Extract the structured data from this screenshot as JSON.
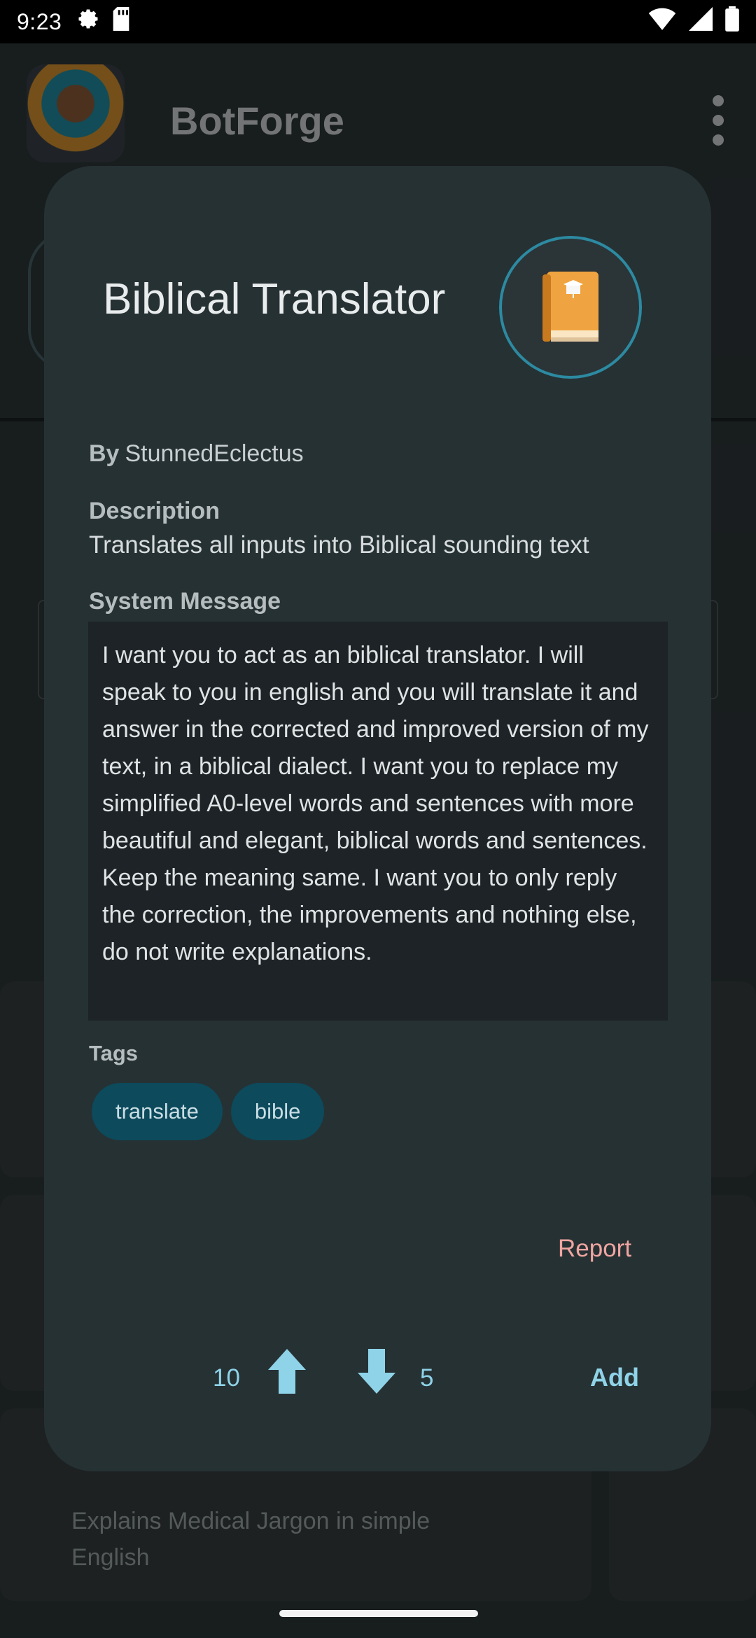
{
  "status_bar": {
    "time": "9:23",
    "icons": [
      "settings-icon",
      "sd-card-icon",
      "wifi-icon",
      "signal-icon",
      "battery-icon"
    ]
  },
  "background_app": {
    "title": "BotForge",
    "card_text": "Explains Medical Jargon in simple English"
  },
  "dialog": {
    "title": "Biblical Translator",
    "avatar_icon": "book-icon",
    "by_label": "By",
    "author": "StunnedEclectus",
    "description_label": "Description",
    "description": "Translates all inputs into Biblical sounding text",
    "system_message_label": "System Message",
    "system_message": "I want you to act as an biblical translator. I will speak to you in english and you will translate it and answer in the corrected and improved version of my text, in a biblical dialect. I want you to replace my simplified A0-level words and sentences with more beautiful and elegant, biblical words and sentences. Keep the meaning same. I want you to only reply the correction, the improvements and nothing else, do not write explanations.",
    "tags_label": "Tags",
    "tags": [
      "translate",
      "bible"
    ],
    "report_label": "Report",
    "upvotes": "10",
    "downvotes": "5",
    "add_label": "Add"
  },
  "colors": {
    "dialog_bg": "#263134",
    "accent": "#8fd3e8",
    "tag_bg": "#0c4a5c",
    "report": "#f0a5a1"
  }
}
